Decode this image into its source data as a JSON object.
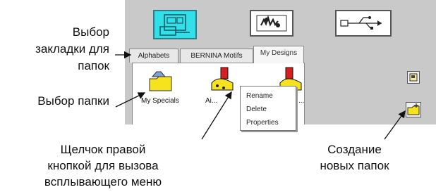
{
  "toolbar": {
    "buttons": [
      {
        "icon": "embroidery-machine-icon",
        "active": true
      },
      {
        "icon": "design-icon",
        "active": false
      },
      {
        "icon": "usb-icon",
        "active": false
      }
    ]
  },
  "tabs": [
    {
      "label": "Alphabets",
      "active": false
    },
    {
      "label": "BERNINA Motifs",
      "active": false
    },
    {
      "label": "My Designs",
      "active": true
    }
  ],
  "folders": [
    {
      "label": "My Specials",
      "icon": "folder-icon"
    },
    {
      "label": "Ai...",
      "icon": "design-folder-icon"
    },
    {
      "label": "...",
      "icon": "design-folder-icon"
    }
  ],
  "context_menu": {
    "items": [
      "Rename",
      "Delete",
      "Properties"
    ]
  },
  "side_buttons": [
    {
      "icon": "folder-view-icon"
    },
    {
      "icon": "new-folder-icon"
    }
  ],
  "annotations": {
    "tab_select": [
      "Выбор",
      "закладки для",
      "папок"
    ],
    "folder_select": "Выбор папки",
    "right_click": [
      "Щелчок правой",
      "кнопкой для вызова",
      "всплывающего меню"
    ],
    "create_folders": [
      "Создание",
      "новых папок"
    ]
  },
  "colors": {
    "panel_bg": "#c9c9c9",
    "active_button": "#31e0e9",
    "folder_yellow": "#f7e21e",
    "design_red": "#d81f1f"
  }
}
